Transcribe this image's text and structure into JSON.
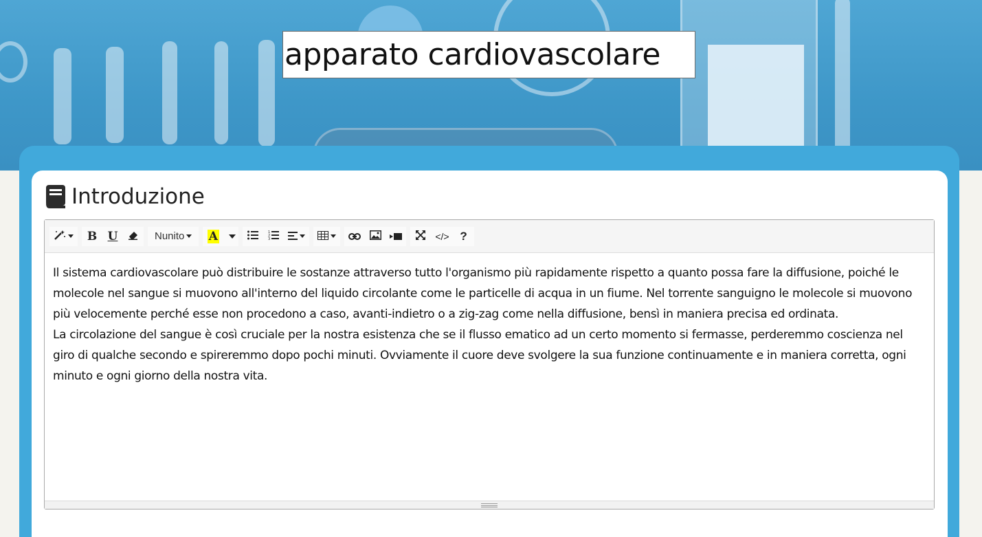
{
  "header": {
    "title_value": "apparato cardiovascolare"
  },
  "section": {
    "icon": "book-icon",
    "title": "Introduzione"
  },
  "toolbar": {
    "style_icon": "magic-wand-icon",
    "bold_label": "B",
    "underline_label": "U",
    "clear_icon": "eraser-icon",
    "font_label": "Nunito",
    "color_label": "A",
    "highlight_color": "#ffff00",
    "unordered_icon": "unordered-list-icon",
    "ordered_icon": "ordered-list-icon",
    "align_icon": "align-left-icon",
    "table_icon": "table-icon",
    "link_icon": "link-icon",
    "picture_icon": "picture-icon",
    "video_icon": "video-icon",
    "fullscreen_icon": "fullscreen-icon",
    "code_label": "</>",
    "help_label": "?"
  },
  "editor": {
    "paragraphs": [
      "Il sistema cardiovascolare può distribuire le sostanze attraverso tutto l'organismo più rapidamente rispetto a quanto possa fare la diffusione, poiché le molecole nel sangue si muovono all'interno del liquido circolante come le particelle di acqua in un fiume. Nel torrente sanguigno le molecole si muovono più velocemente perché esse non procedono a caso, avanti-indietro o a zig-zag come nella diffusione, bensì in maniera precisa ed ordinata.",
      "La circolazione del sangue è così cruciale per la nostra esistenza che se il flusso ematico ad un certo momento si fermasse, perderemmo coscienza nel giro di qualche secondo e spireremmo dopo pochi minuti. Ovviamente il cuore deve svolgere la sua funzione continuamente e in maniera corretta, ogni minuto e ogni giorno della nostra vita."
    ]
  },
  "colors": {
    "panel": "#41a9db",
    "background": "#f4f3ee"
  }
}
